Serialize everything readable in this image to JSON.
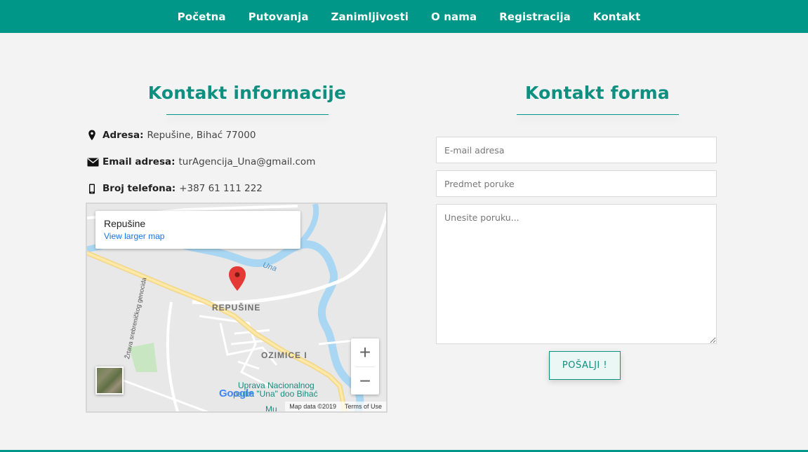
{
  "nav": {
    "items": [
      {
        "label": "Početna"
      },
      {
        "label": "Putovanja"
      },
      {
        "label": "Zanimljivosti"
      },
      {
        "label": "O nama"
      },
      {
        "label": "Registracija"
      },
      {
        "label": "Kontakt"
      }
    ]
  },
  "contact_info": {
    "title": "Kontakt informacije",
    "address_label": "Adresa:",
    "address_value": "Repušine, Bihać 77000",
    "email_label": "Email adresa:",
    "email_value": "turAgencija_Una@gmail.com",
    "phone_label": "Broj telefona:",
    "phone_value": "+387 61 111 222",
    "icons": [
      "map-marker-icon",
      "envelope-icon",
      "mobile-phone-icon"
    ]
  },
  "map": {
    "place_name": "Repušine",
    "larger_map_link": "View larger map",
    "label_repusine": "REPUŠINE",
    "label_ozimice": "OZIMICE I",
    "label_una": "Una",
    "label_street": "Žrtava srebreničkog genocida",
    "label_poi_1": "Uprava Nacionalnog",
    "label_poi_2": "parka \"Una\" doo Bihać",
    "label_bottom": "Mu",
    "zoom_in": "+",
    "zoom_out": "−",
    "attribution": "Map data ©2019",
    "terms": "Terms of Use",
    "logo": "Google"
  },
  "contact_form": {
    "title": "Kontakt forma",
    "email_placeholder": "E-mail adresa",
    "subject_placeholder": "Predmet poruke",
    "message_placeholder": "Unesite poruku...",
    "submit_label": "POŠALJI !"
  },
  "colors": {
    "brand": "#009688",
    "title": "#0f8f80",
    "background": "#f3f3f3"
  }
}
